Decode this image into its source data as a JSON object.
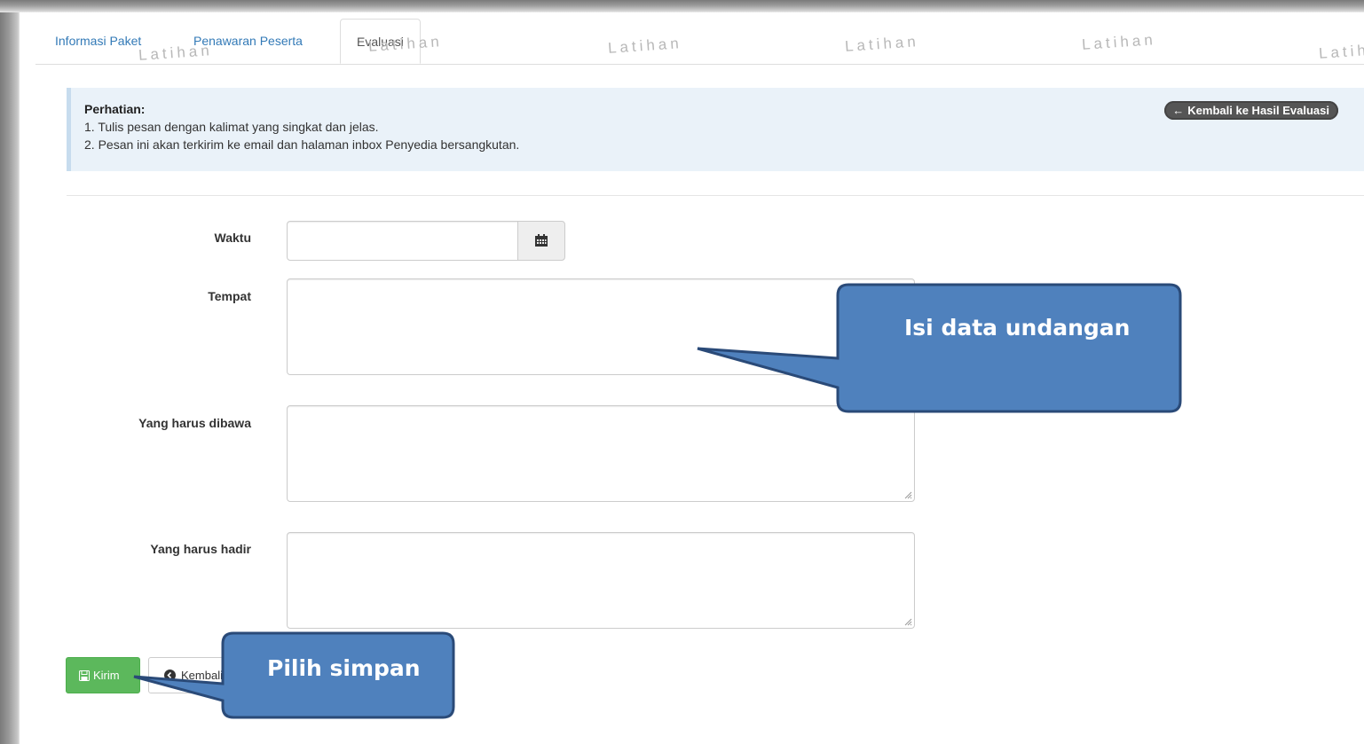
{
  "tabs": [
    {
      "label": "Informasi Paket"
    },
    {
      "label": "Penawaran Peserta"
    },
    {
      "label": "Evaluasi"
    }
  ],
  "watermark": "Latihan",
  "alert": {
    "title": "Perhatian:",
    "lines": [
      "1. Tulis pesan dengan kalimat yang singkat dan jelas.",
      "2. Pesan ini akan terkirim ke email dan halaman inbox Penyedia bersangkutan."
    ],
    "back_label": "Kembali ke Hasil Evaluasi"
  },
  "form": {
    "waktu_label": "Waktu",
    "tempat_label": "Tempat",
    "dibawa_label": "Yang harus dibawa",
    "hadir_label": "Yang harus hadir"
  },
  "buttons": {
    "kirim": "Kirim",
    "kembali": "Kembali"
  },
  "callouts": {
    "isi_data": "Isi data undangan",
    "pilih_simpan": "Pilih simpan"
  },
  "colors": {
    "callout_fill": "#4f81bd",
    "callout_border": "#2a4a78",
    "kirim_green": "#5cb85c"
  }
}
